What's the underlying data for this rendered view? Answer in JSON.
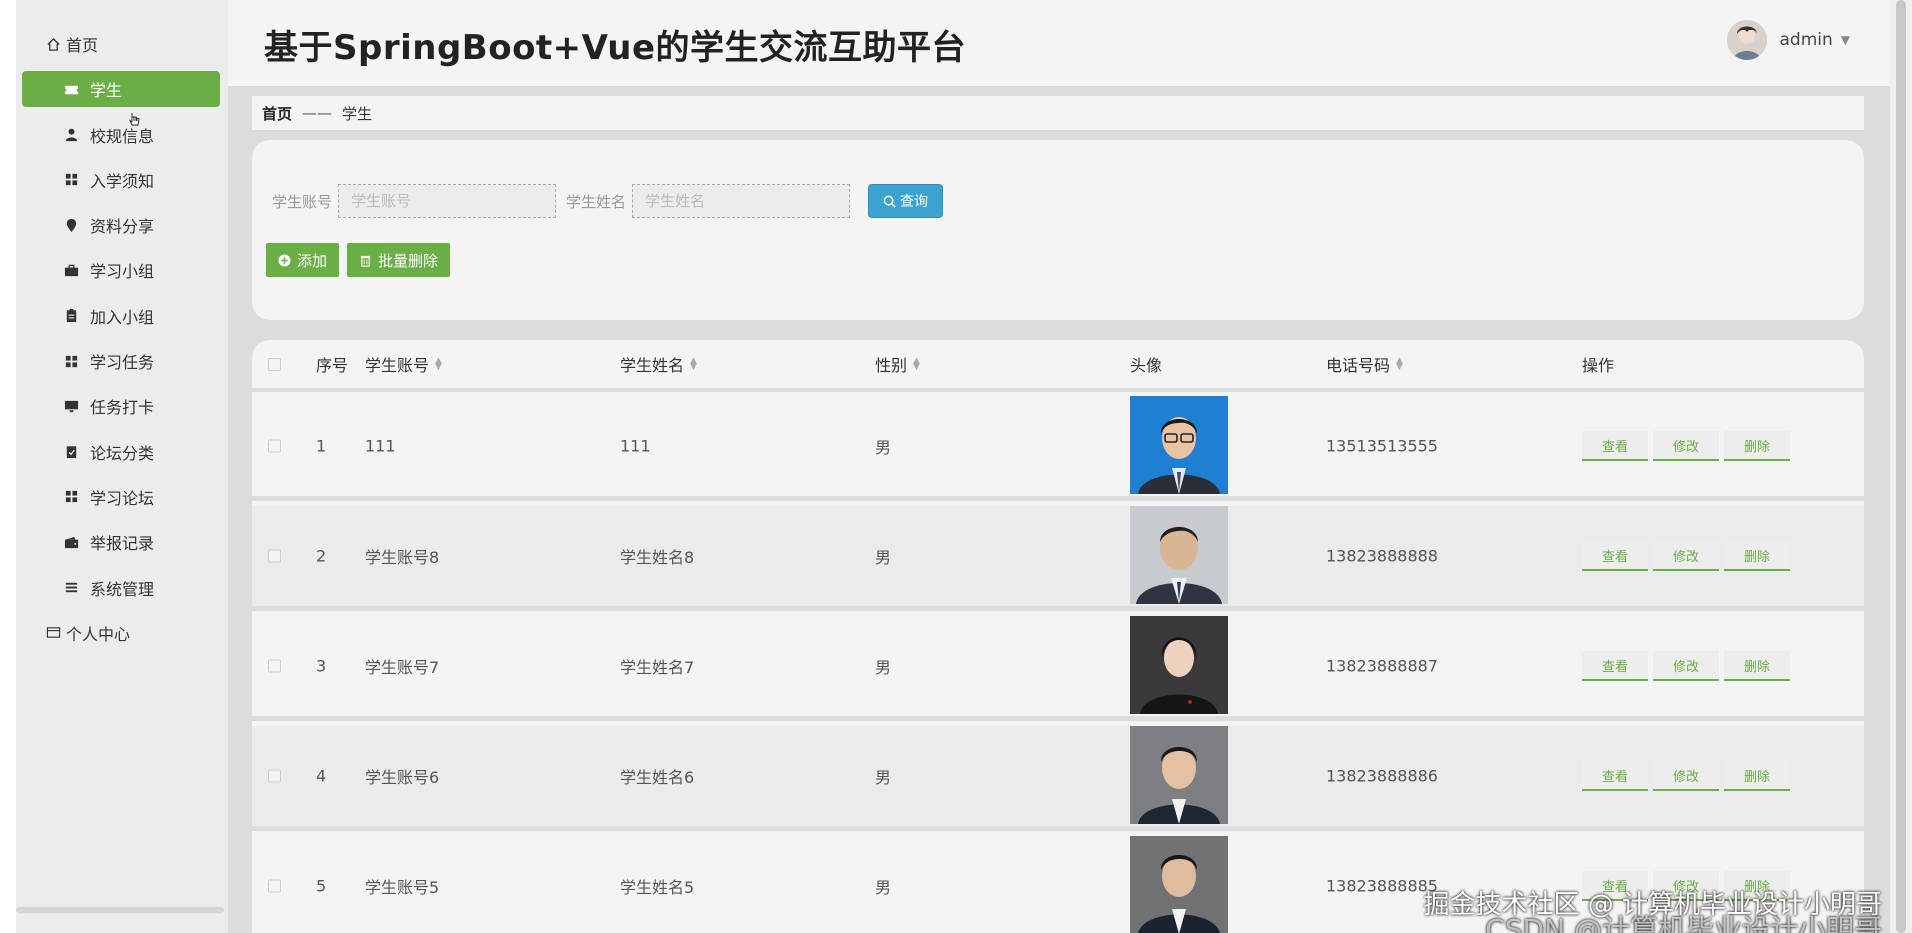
{
  "header": {
    "title": "基于SpringBoot+Vue的学生交流互助平台",
    "user_name": "admin"
  },
  "sidebar": {
    "items": [
      {
        "label": "首页",
        "icon": "home-icon"
      },
      {
        "label": "学生",
        "icon": "ticket-icon"
      },
      {
        "label": "校规信息",
        "icon": "user-icon"
      },
      {
        "label": "入学须知",
        "icon": "grid-icon"
      },
      {
        "label": "资料分享",
        "icon": "pin-icon"
      },
      {
        "label": "学习小组",
        "icon": "briefcase-icon"
      },
      {
        "label": "加入小组",
        "icon": "clipboard-icon"
      },
      {
        "label": "学习任务",
        "icon": "grid-icon"
      },
      {
        "label": "任务打卡",
        "icon": "monitor-icon"
      },
      {
        "label": "论坛分类",
        "icon": "checklist-icon"
      },
      {
        "label": "学习论坛",
        "icon": "grid-icon"
      },
      {
        "label": "举报记录",
        "icon": "wallet-icon"
      },
      {
        "label": "系统管理",
        "icon": "list-icon"
      },
      {
        "label": "个人中心",
        "icon": "profile-card-icon"
      }
    ]
  },
  "breadcrumb": {
    "home": "首页",
    "separator": "——",
    "current": "学生"
  },
  "search": {
    "account_label": "学生账号",
    "account_placeholder": "学生账号",
    "name_label": "学生姓名",
    "name_placeholder": "学生姓名",
    "query_label": "查询"
  },
  "actions": {
    "add_label": "添加",
    "batch_delete_label": "批量删除"
  },
  "table": {
    "columns": [
      "序号",
      "学生账号",
      "学生姓名",
      "性别",
      "头像",
      "电话号码",
      "操作"
    ],
    "rows": [
      {
        "index": "1",
        "account": "111",
        "name": "111",
        "gender": "男",
        "phone": "13513513555"
      },
      {
        "index": "2",
        "account": "学生账号8",
        "name": "学生姓名8",
        "gender": "男",
        "phone": "13823888888"
      },
      {
        "index": "3",
        "account": "学生账号7",
        "name": "学生姓名7",
        "gender": "男",
        "phone": "13823888887"
      },
      {
        "index": "4",
        "account": "学生账号6",
        "name": "学生姓名6",
        "gender": "男",
        "phone": "13823888886"
      },
      {
        "index": "5",
        "account": "学生账号5",
        "name": "学生姓名5",
        "gender": "男",
        "phone": "13823888885"
      }
    ],
    "op_view": "查看",
    "op_edit": "修改",
    "op_delete": "删除"
  },
  "watermark": {
    "line1": "掘金技术社区 @ 计算机毕业设计小明哥",
    "line2": "CSDN @计算机毕业设计小明哥"
  },
  "colors": {
    "accent_green": "#6aae45",
    "search_blue": "#3ca3d0"
  }
}
